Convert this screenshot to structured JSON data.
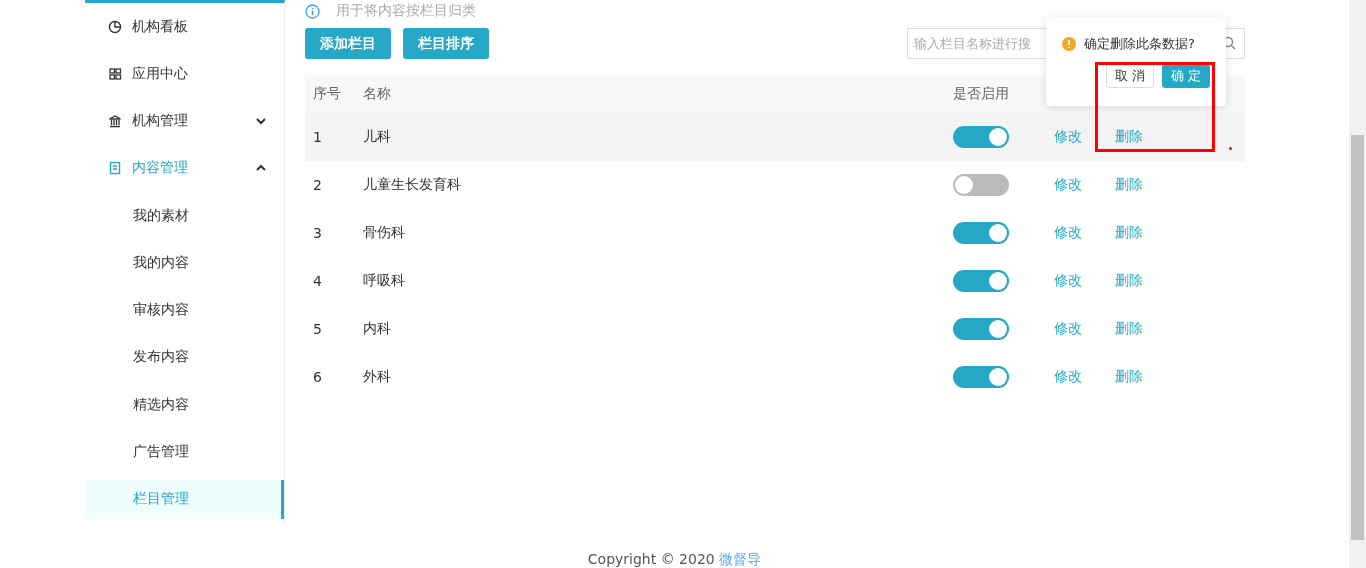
{
  "sidebar": {
    "items": [
      {
        "label": "机构看板",
        "selected": false
      },
      {
        "label": "应用中心",
        "selected": false
      },
      {
        "label": "机构管理",
        "selected": false,
        "expanded": false
      },
      {
        "label": "内容管理",
        "selected": false,
        "expanded": true,
        "children": [
          {
            "label": "我的素材",
            "selected": false
          },
          {
            "label": "我的内容",
            "selected": false
          },
          {
            "label": "审核内容",
            "selected": false
          },
          {
            "label": "发布内容",
            "selected": false
          },
          {
            "label": "精选内容",
            "selected": false
          },
          {
            "label": "广告管理",
            "selected": false
          },
          {
            "label": "栏目管理",
            "selected": true
          }
        ]
      }
    ]
  },
  "hint": "用于将内容按栏目归类",
  "buttons": [
    "添加栏目",
    "栏目排序"
  ],
  "search": {
    "placeholder": "输入栏目名称进行搜"
  },
  "table": {
    "columns": [
      "序号",
      "名称",
      "是否启用"
    ],
    "rows": [
      {
        "index": "1",
        "name": "儿科",
        "enabled": true,
        "highlighted": true,
        "edit": "修改",
        "delete": "删除"
      },
      {
        "index": "2",
        "name": "儿童生长发育科",
        "enabled": false,
        "highlighted": false,
        "edit": "修改",
        "delete": "删除"
      },
      {
        "index": "3",
        "name": "骨伤科",
        "enabled": true,
        "highlighted": false,
        "edit": "修改",
        "delete": "删除"
      },
      {
        "index": "4",
        "name": "呼吸科",
        "enabled": true,
        "highlighted": false,
        "edit": "修改",
        "delete": "删除"
      },
      {
        "index": "5",
        "name": "内科",
        "enabled": true,
        "highlighted": false,
        "edit": "修改",
        "delete": "删除"
      },
      {
        "index": "6",
        "name": "外科",
        "enabled": true,
        "highlighted": false,
        "edit": "修改",
        "delete": "删除"
      }
    ]
  },
  "popconfirm": {
    "message": "确定删除此条数据?",
    "cancel": "取 消",
    "confirm": "确 定"
  },
  "footer": {
    "text": "Copyright © 2020",
    "link": "微督导"
  }
}
